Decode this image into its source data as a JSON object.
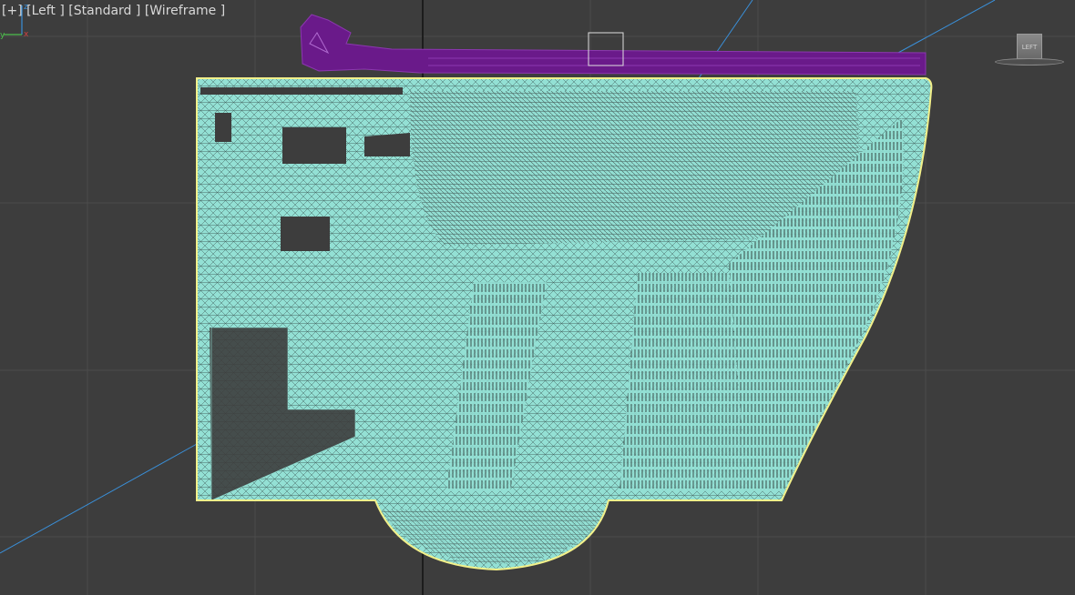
{
  "viewport": {
    "label": {
      "plus": "[+]",
      "view": "[Left ]",
      "shading_mode": "[Standard ]",
      "display_mode": "[Wireframe ]"
    },
    "viewcube_face": "LEFT",
    "axis_y": "y",
    "axis_z": "z",
    "colors": {
      "background": "#3d3d3d",
      "grid": "#4b4b4b",
      "object_wire": "#93e0d4",
      "selection_outline": "#f2f08a",
      "seat_object": "#6a1a8a",
      "blue_line": "#3a8fd8"
    }
  }
}
